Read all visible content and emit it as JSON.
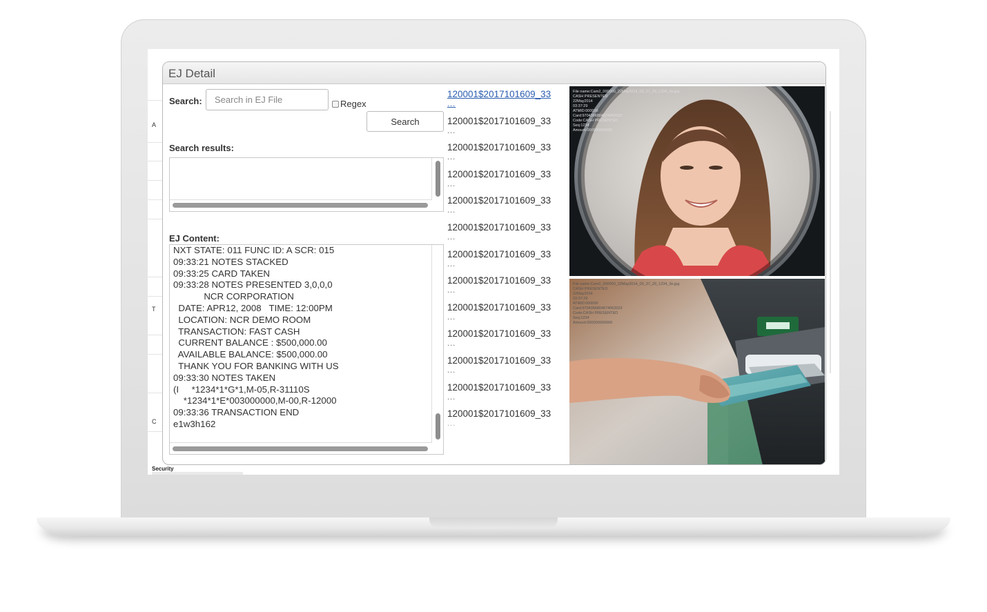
{
  "window": {
    "title": "EJ Detail"
  },
  "background": {
    "footer_label": "Security",
    "side_marks": [
      "A",
      "T",
      "C"
    ]
  },
  "search": {
    "label": "Search:",
    "placeholder": "Search in EJ File",
    "regex_label": "Regex",
    "button_label": "Search",
    "results_label": "Search results:"
  },
  "ej_content": {
    "label": "EJ Content:",
    "lines": [
      "NXT STATE: 011 FUNC ID: A SCR: 015",
      "09:33:21 NOTES STACKED",
      "09:33:25 CARD TAKEN",
      "09:33:28 NOTES PRESENTED 3,0,0,0",
      "            NCR CORPORATION",
      "  DATE: APR12, 2008   TIME: 12:00PM",
      "  LOCATION: NCR DEMO ROOM",
      "  TRANSACTION: FAST CASH",
      "  CURRENT BALANCE : $500,000.00",
      "  AVAILABLE BALANCE: $500,000.00",
      "  THANK YOU FOR BANKING WITH US",
      "09:33:30 NOTES TAKEN",
      "(I     *1234*1*G*1,M-05,R-31110S",
      "    *1234*1*E*003000000,M-00,R-12000",
      "09:33:36 TRANSACTION END",
      "e1w3h162"
    ]
  },
  "files": {
    "items": [
      "120001$2017101609_33",
      "120001$2017101609_33",
      "120001$2017101609_33",
      "120001$2017101609_33",
      "120001$2017101609_33",
      "120001$2017101609_33",
      "120001$2017101609_33",
      "120001$2017101609_33",
      "120001$2017101609_33",
      "120001$2017101609_33",
      "120001$2017101609_33",
      "120001$2017101609_33",
      "120001$2017101609_33"
    ],
    "more": "..."
  },
  "cameras": [
    {
      "overlay": "File name:Cam2_000000_22May2014_03_37_29_1234_3e.jpg\nCASH PRESENTED\n22May2014\n03:37:29\nATMID:000000\nCard:9704366804674062022\nCode:CASH PRESENTED\nSeq:1234\nAmount:000000000000"
    },
    {
      "overlay": "File name:Cam2_000000_22May2014_03_37_29_1234_3e.jpg\nCASH PRESENTED\n22May2014\n03:37:29\nATMID:000000\nCard:9704366804674062023\nCode:CASH PRESENTED\nSeq:1234\nAmount:000000000000"
    }
  ]
}
